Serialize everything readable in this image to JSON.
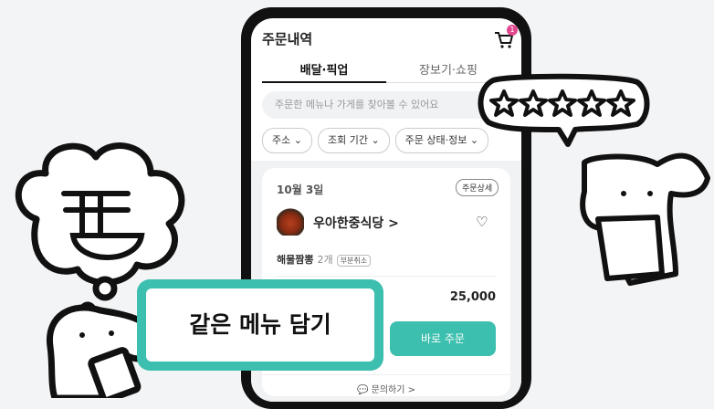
{
  "header": {
    "title": "주문내역",
    "cart_count": "1"
  },
  "tabs": [
    {
      "label": "배달·픽업"
    },
    {
      "label": "장보기·쇼핑"
    }
  ],
  "search": {
    "placeholder": "주문한 메뉴나 가게를 찾아볼 수 있어요"
  },
  "filters": [
    {
      "label": "주소 ⌄"
    },
    {
      "label": "조회 기간 ⌄"
    },
    {
      "label": "주문 상태·정보 ⌄"
    }
  ],
  "order": {
    "date": "10월 3일",
    "detail_label": "주문상세",
    "store": "우아한중식당 >",
    "item": "해물짬뽕",
    "qty": "2개",
    "cancel_badge": "부분취소",
    "price": "25,000",
    "reorder_label": "바로 주문",
    "inquiry_label": "문의하기 >"
  },
  "overlay": {
    "label": "같은 메뉴 담기"
  },
  "colors": {
    "accent": "#3cbfae",
    "badge": "#e3488f"
  }
}
